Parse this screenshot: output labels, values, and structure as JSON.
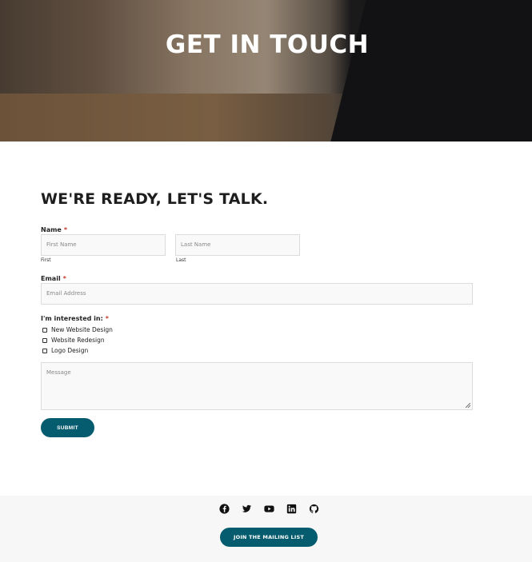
{
  "hero": {
    "title": "GET IN TOUCH"
  },
  "form": {
    "heading": "WE'RE READY, LET'S TALK.",
    "required_mark": "*",
    "name_label": "Name",
    "first_placeholder": "First Name",
    "last_placeholder": "Last Name",
    "first_sublabel": "First",
    "last_sublabel": "Last",
    "email_label": "Email",
    "email_placeholder": "Email Address",
    "interest_label": "I'm interested in:",
    "interests": [
      "New Website Design",
      "Website Redesign",
      "Logo Design"
    ],
    "message_placeholder": "Message",
    "submit_label": "SUBMIT"
  },
  "footer": {
    "social_icons": [
      "facebook-icon",
      "twitter-icon",
      "youtube-icon",
      "linkedin-icon",
      "github-icon"
    ],
    "mailing_label": "JOIN THE MAILING LIST"
  },
  "colors": {
    "accent": "#065c6f",
    "required": "#c0392b",
    "footer_bg": "#f7f7f7"
  }
}
